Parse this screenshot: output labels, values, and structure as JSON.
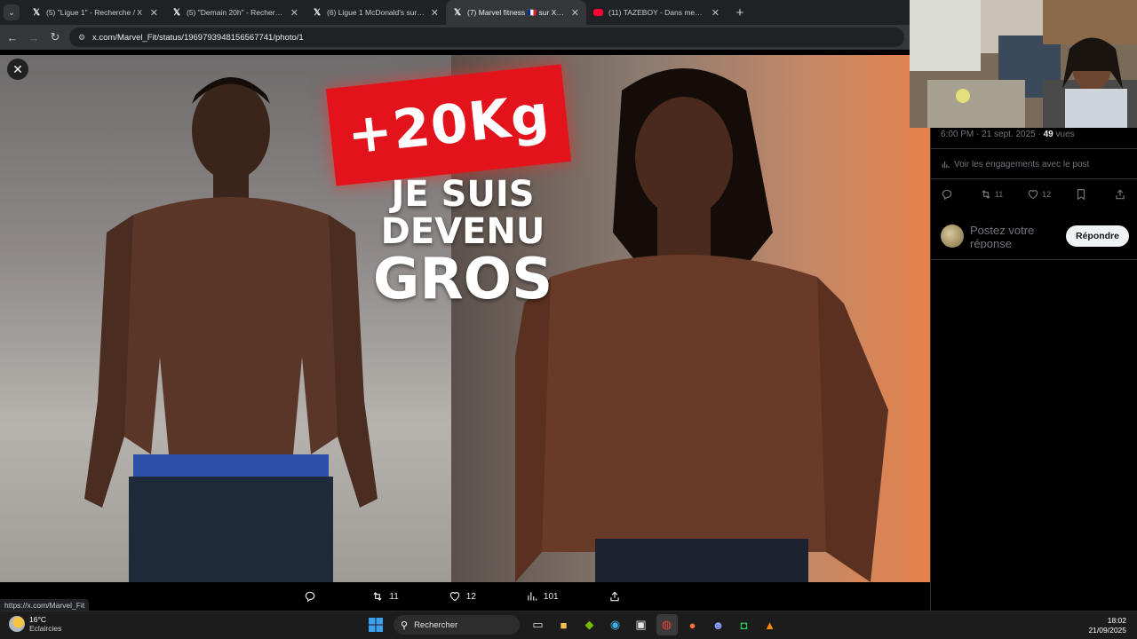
{
  "browser": {
    "tabs": [
      {
        "title": "(5) \"Ligue 1\" - Recherche / X",
        "favicon": "x-logo",
        "active": false
      },
      {
        "title": "(5) \"Demain 20h\" - Recherche / X",
        "favicon": "x-logo",
        "active": false
      },
      {
        "title": "(6) Ligue 1 McDonald's sur X : \"",
        "favicon": "x-logo",
        "active": false
      },
      {
        "title": "(7) Marvel fitness 🇫🇷 sur X : \"« Je",
        "favicon": "x-logo",
        "active": true
      },
      {
        "title": "(11) TAZEBOY - Dans mes bails",
        "favicon": "youtube-logo",
        "active": false
      }
    ],
    "new_tab_label": "+",
    "url": "x.com/Marvel_Fit/status/1969793948156567741/photo/1",
    "status_url": "https://x.com/Marvel_Fit"
  },
  "photo": {
    "headline": "+20Kg",
    "tagline_lines": [
      "JE SUIS",
      "DEVENU",
      "GROS"
    ]
  },
  "viewer_actions": {
    "reposts": "11",
    "likes": "12",
    "views": "101"
  },
  "post": {
    "time_date": "6:00 PM · 21 sept. 2025 · ",
    "views_count": "49",
    "views_label": " vues",
    "engagements_link": "Voir les engagements avec le post",
    "reposts": "11",
    "likes": "12",
    "reply_placeholder": "Postez votre réponse",
    "reply_button": "Répondre"
  },
  "taskbar": {
    "temperature": "16°C",
    "weather": "Eclaircies",
    "search_placeholder": "Rechercher",
    "time": "18:02",
    "date": "21/09/2025"
  },
  "colors": {
    "accent_red": "#e3131b",
    "x_background": "#000000",
    "muted_text": "#71767b"
  }
}
